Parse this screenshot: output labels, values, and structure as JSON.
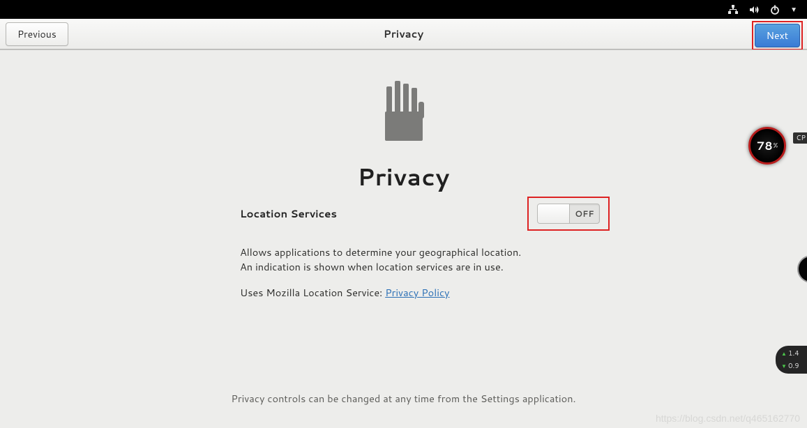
{
  "sysbar": {
    "icons": [
      "network-icon",
      "volume-icon",
      "power-icon",
      "dropdown-icon"
    ]
  },
  "header": {
    "previous_label": "Previous",
    "title": "Privacy",
    "next_label": "Next"
  },
  "hero": {
    "title": "Privacy"
  },
  "location": {
    "label": "Location Services",
    "toggle_state": "OFF",
    "description": "Allows applications to determine your geographical location. An indication is shown when location services are in use.",
    "uses_prefix": "Uses Mozilla Location Service: ",
    "privacy_link_label": "Privacy Policy"
  },
  "footer": {
    "note": "Privacy controls can be changed at any time from the Settings application."
  },
  "overlay": {
    "gauge_value": "78",
    "gauge_pct": "%",
    "gauge_label": "CP",
    "net_up": "1.4",
    "net_dn": "0.9"
  },
  "watermark": "https://blog.csdn.net/q465162770"
}
